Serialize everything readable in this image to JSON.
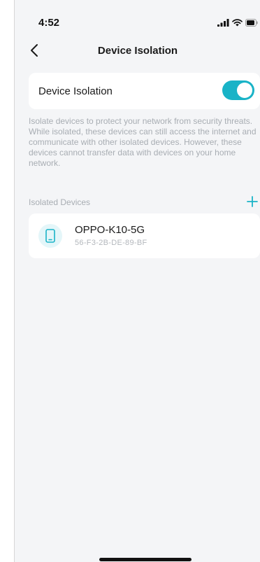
{
  "status_bar": {
    "time": "4:52",
    "signal_icon": "cellular-signal-icon",
    "wifi_icon": "wifi-icon",
    "battery_icon": "battery-icon"
  },
  "nav": {
    "back_icon": "chevron-left-icon",
    "title": "Device Isolation"
  },
  "isolation_setting": {
    "label": "Device Isolation",
    "enabled": true
  },
  "description": "Isolate devices to protect your network from security threats. While isolated, these devices can still access the internet and communicate with other isolated devices. However, these devices cannot transfer data with devices on your home network.",
  "isolated_devices": {
    "section_title": "Isolated Devices",
    "add_icon": "plus-icon",
    "items": [
      {
        "name": "OPPO-K10-5G",
        "mac": "56-F3-2B-DE-89-BF",
        "icon": "smartphone-icon"
      }
    ]
  },
  "colors": {
    "accent": "#19b3c7",
    "background": "#f4f5f7",
    "card": "#ffffff",
    "muted_text": "#a8adb3"
  }
}
